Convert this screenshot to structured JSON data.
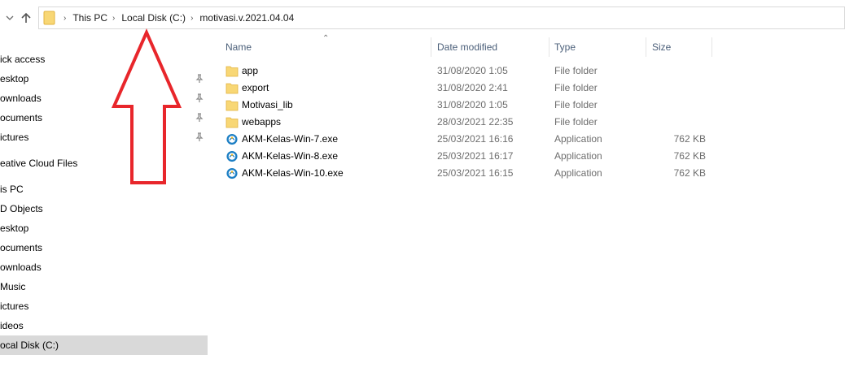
{
  "address_bar": {
    "breadcrumbs": [
      "This PC",
      "Local Disk (C:)",
      "motivasi.v.2021.04.04"
    ]
  },
  "sidebar": {
    "items": [
      {
        "label": "ick access",
        "pinned": false,
        "selected": false
      },
      {
        "label": "esktop",
        "pinned": true,
        "selected": false
      },
      {
        "label": "ownloads",
        "pinned": true,
        "selected": false
      },
      {
        "label": "ocuments",
        "pinned": true,
        "selected": false
      },
      {
        "label": "ictures",
        "pinned": true,
        "selected": false
      },
      {
        "label": "eative Cloud Files",
        "pinned": false,
        "selected": false
      },
      {
        "label": "is PC",
        "pinned": false,
        "selected": false
      },
      {
        "label": "D Objects",
        "pinned": false,
        "selected": false
      },
      {
        "label": "esktop",
        "pinned": false,
        "selected": false
      },
      {
        "label": "ocuments",
        "pinned": false,
        "selected": false
      },
      {
        "label": "ownloads",
        "pinned": false,
        "selected": false
      },
      {
        "label": "Music",
        "pinned": false,
        "selected": false
      },
      {
        "label": "ictures",
        "pinned": false,
        "selected": false
      },
      {
        "label": "ideos",
        "pinned": false,
        "selected": false
      },
      {
        "label": "ocal Disk (C:)",
        "pinned": false,
        "selected": true
      }
    ]
  },
  "file_list": {
    "columns": [
      "Name",
      "Date modified",
      "Type",
      "Size"
    ],
    "rows": [
      {
        "name": "app",
        "date": "31/08/2020 1:05",
        "type": "File folder",
        "size": "",
        "icon": "folder-icon"
      },
      {
        "name": "export",
        "date": "31/08/2020 2:41",
        "type": "File folder",
        "size": "",
        "icon": "folder-icon"
      },
      {
        "name": "Motivasi_lib",
        "date": "31/08/2020 1:05",
        "type": "File folder",
        "size": "",
        "icon": "folder-icon"
      },
      {
        "name": "webapps",
        "date": "28/03/2021 22:35",
        "type": "File folder",
        "size": "",
        "icon": "folder-icon"
      },
      {
        "name": "AKM-Kelas-Win-7.exe",
        "date": "25/03/2021 16:16",
        "type": "Application",
        "size": "762 KB",
        "icon": "application-icon"
      },
      {
        "name": "AKM-Kelas-Win-8.exe",
        "date": "25/03/2021 16:17",
        "type": "Application",
        "size": "762 KB",
        "icon": "application-icon"
      },
      {
        "name": "AKM-Kelas-Win-10.exe",
        "date": "25/03/2021 16:15",
        "type": "Application",
        "size": "762 KB",
        "icon": "application-icon"
      }
    ]
  },
  "colors": {
    "folder": "#f8d775",
    "annotation_arrow": "#e8262b",
    "selected_bg": "#d9d9d9",
    "header_text": "#4c607a"
  }
}
